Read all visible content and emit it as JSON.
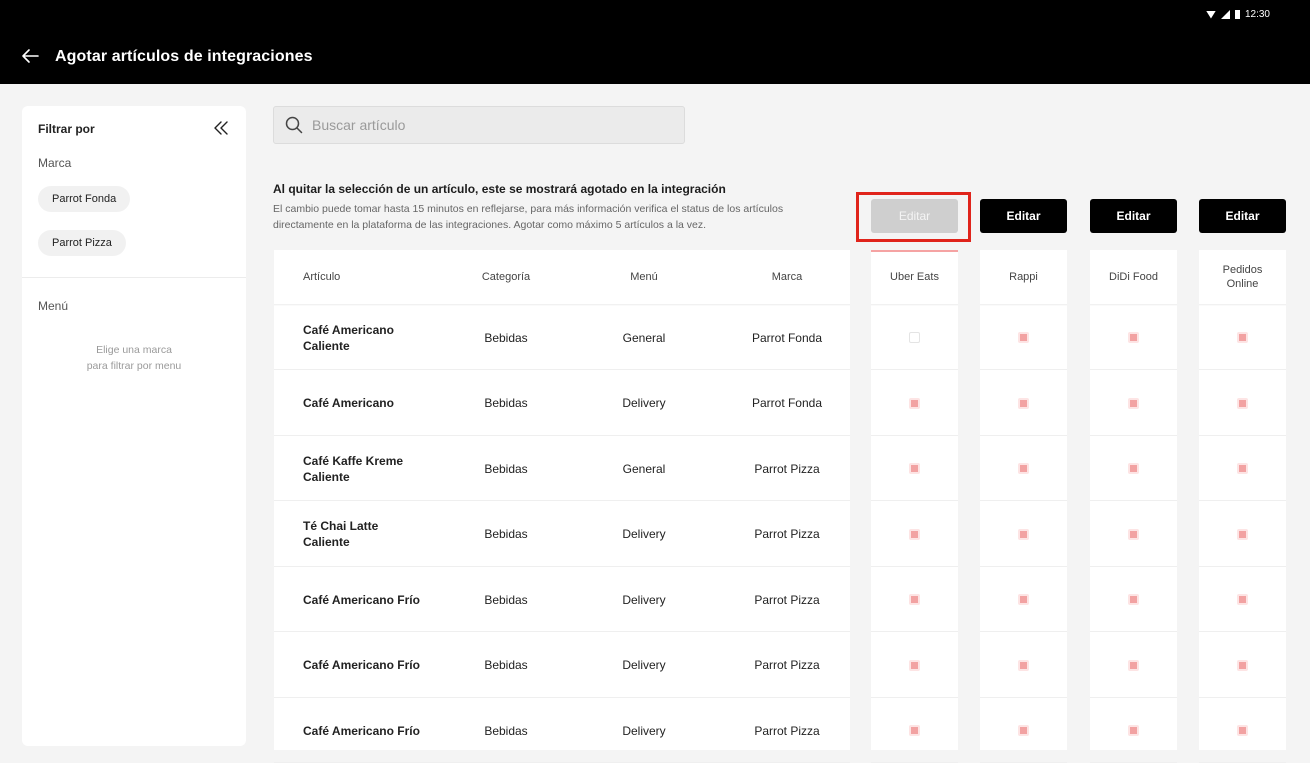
{
  "status_bar": {
    "time": "12:30"
  },
  "header": {
    "title": "Agotar artículos de integraciones"
  },
  "sidebar": {
    "title": "Filtrar por",
    "brand_label": "Marca",
    "brands": [
      "Parrot Fonda",
      "Parrot Pizza"
    ],
    "menu_label": "Menú",
    "menu_hint_line1": "Elige una marca",
    "menu_hint_line2": "para filtrar por menu"
  },
  "search": {
    "placeholder": "Buscar artículo",
    "value": ""
  },
  "info": {
    "title": "Al quitar la selección de un artículo, este se mostrará agotado en la integración",
    "description": "El cambio puede tomar hasta 15 minutos en reflejarse, para más información verifica el status de los artículos directamente en la plataforma de las integraciones. Agotar como máximo 5 artículos a la vez."
  },
  "edit_label": "Editar",
  "table": {
    "columns": [
      "Artículo",
      "Categoría",
      "Menú",
      "Marca"
    ],
    "integrations": [
      "Uber Eats",
      "Rappi",
      "DiDi Food",
      "Pedidos Online"
    ],
    "rows": [
      {
        "item": "Café Americano Caliente",
        "category": "Bebidas",
        "menu": "General",
        "brand": "Parrot Fonda",
        "checks": [
          false,
          true,
          true,
          true
        ]
      },
      {
        "item": "Café Americano",
        "category": "Bebidas",
        "menu": "Delivery",
        "brand": "Parrot Fonda",
        "checks": [
          true,
          true,
          true,
          true
        ]
      },
      {
        "item": "Café Kaffe Kreme Caliente",
        "category": "Bebidas",
        "menu": "General",
        "brand": "Parrot Pizza",
        "checks": [
          true,
          true,
          true,
          true
        ]
      },
      {
        "item": "Té Chai Latte Caliente",
        "category": "Bebidas",
        "menu": "Delivery",
        "brand": "Parrot Pizza",
        "checks": [
          true,
          true,
          true,
          true
        ]
      },
      {
        "item": "Café Americano Frío",
        "category": "Bebidas",
        "menu": "Delivery",
        "brand": "Parrot Pizza",
        "checks": [
          true,
          true,
          true,
          true
        ]
      },
      {
        "item": "Café Americano Frío",
        "category": "Bebidas",
        "menu": "Delivery",
        "brand": "Parrot Pizza",
        "checks": [
          true,
          true,
          true,
          true
        ]
      },
      {
        "item": "Café Americano Frío",
        "category": "Bebidas",
        "menu": "Delivery",
        "brand": "Parrot Pizza",
        "checks": [
          true,
          true,
          true,
          true
        ]
      }
    ]
  }
}
